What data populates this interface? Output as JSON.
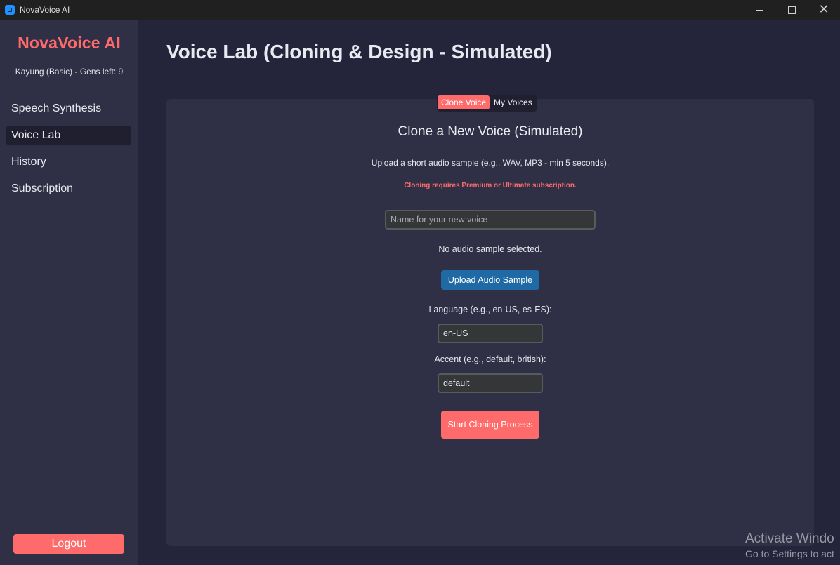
{
  "window": {
    "title": "NovaVoice AI",
    "controls": {
      "minimize": "minimize-icon",
      "maximize": "maximize-icon",
      "close": "close-icon"
    }
  },
  "sidebar": {
    "brand": "NovaVoice AI",
    "user_info": "Kayung (Basic) - Gens left: 9",
    "items": [
      {
        "label": "Speech Synthesis",
        "active": false
      },
      {
        "label": "Voice Lab",
        "active": true
      },
      {
        "label": "History",
        "active": false
      },
      {
        "label": "Subscription",
        "active": false
      }
    ],
    "logout_label": "Logout"
  },
  "main": {
    "page_title": "Voice Lab (Cloning & Design - Simulated)",
    "tabs": [
      {
        "label": "Clone Voice",
        "active": true
      },
      {
        "label": "My Voices",
        "active": false
      }
    ],
    "clone": {
      "section_title": "Clone a New Voice (Simulated)",
      "upload_hint": "Upload a short audio sample (e.g., WAV, MP3 - min 5 seconds).",
      "premium_warning": "Cloning requires Premium or Ultimate subscription.",
      "name_placeholder": "Name for your new voice",
      "name_value": "",
      "sample_status": "No audio sample selected.",
      "upload_button": "Upload Audio Sample",
      "language_label": "Language (e.g., en-US, es-ES):",
      "language_value": "en-US",
      "accent_label": "Accent (e.g., default, british):",
      "accent_value": "default",
      "start_button": "Start Cloning Process"
    }
  },
  "watermark": {
    "line1": "Activate Windo",
    "line2": "Go to Settings to act"
  },
  "colors": {
    "accent": "#ff6b6b",
    "primary_button": "#1f6aa5",
    "background": "#24243a",
    "sidebar": "#2f2f45",
    "panel": "#2f2f45"
  }
}
